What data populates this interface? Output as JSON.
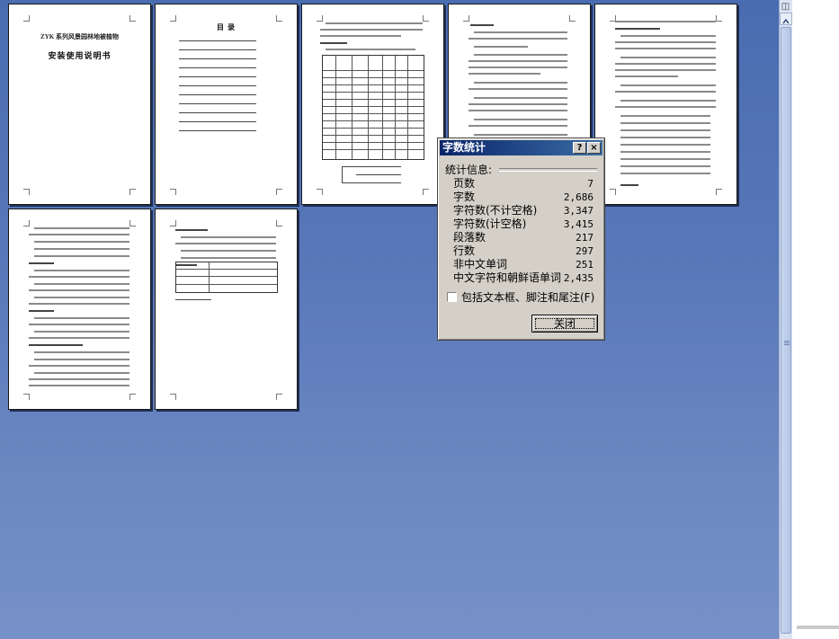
{
  "document": {
    "page1_title_line1": "ZYK 系列风景园林地被植物",
    "page1_title_line2": "安装使用说明书",
    "page2_heading": "目    录"
  },
  "dialog": {
    "title": "字数统计",
    "help_button": "?",
    "close_x": "×",
    "group_label": "统计信息:",
    "stats": [
      {
        "label": "页数",
        "value": "7"
      },
      {
        "label": "字数",
        "value": "2,686"
      },
      {
        "label": "字符数(不计空格)",
        "value": "3,347"
      },
      {
        "label": "字符数(计空格)",
        "value": "3,415"
      },
      {
        "label": "段落数",
        "value": "217"
      },
      {
        "label": "行数",
        "value": "297"
      },
      {
        "label": "非中文单词",
        "value": "251"
      },
      {
        "label": "中文字符和朝鲜语单词",
        "value": "2,435"
      }
    ],
    "checkbox_label": "包括文本框、脚注和尾注(F)",
    "checkbox_checked": false,
    "close_button": "关闭"
  },
  "icons": {
    "help": "help-icon",
    "close": "close-icon",
    "scroll_up": "chevron-up-icon",
    "scroll_down": "chevron-down-icon"
  },
  "colors": {
    "workspace": "#5877b8",
    "titlebar": "#0a246a",
    "dialog_face": "#d4d0c8"
  }
}
